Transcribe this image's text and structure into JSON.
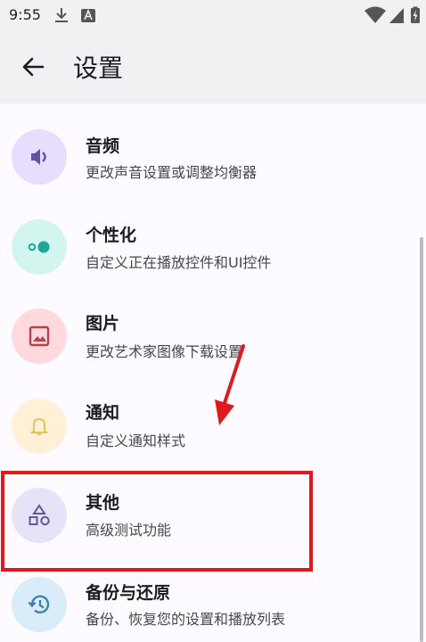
{
  "status_bar": {
    "time": "9:55",
    "icons": [
      "download-icon",
      "a-box-icon",
      "wifi-icon",
      "signal-icon",
      "battery-charging-icon"
    ]
  },
  "app_bar": {
    "back_icon": "arrow-back-icon",
    "title": "设置"
  },
  "settings": {
    "items": [
      {
        "title": "音频",
        "subtitle": "更改声音设置或调整均衡器",
        "icon": "speaker-icon",
        "icon_bg": "#e9ddff",
        "icon_color": "#6650a4"
      },
      {
        "title": "个性化",
        "subtitle": "自定义正在播放控件和UI控件",
        "icon": "toggle-dots-icon",
        "icon_bg": "#d2f5ef",
        "icon_color": "#1fa69a"
      },
      {
        "title": "图片",
        "subtitle": "更改艺术家图像下载设置",
        "icon": "image-icon",
        "icon_bg": "#ffd9de",
        "icon_color": "#b3434e"
      },
      {
        "title": "通知",
        "subtitle": "自定义通知样式",
        "icon": "bell-icon",
        "icon_bg": "#fff0d6",
        "icon_color": "#e6c35c"
      },
      {
        "title": "其他",
        "subtitle": "高级测试功能",
        "icon": "shapes-icon",
        "icon_bg": "#e6e2f7",
        "icon_color": "#5b5a99"
      },
      {
        "title": "备份与还原",
        "subtitle": "备份、恢复您的设置和播放列表",
        "icon": "restore-icon",
        "icon_bg": "#d9ecfa",
        "icon_color": "#3b7fb5"
      }
    ]
  },
  "annotation": {
    "highlight_color": "#e0191e"
  }
}
